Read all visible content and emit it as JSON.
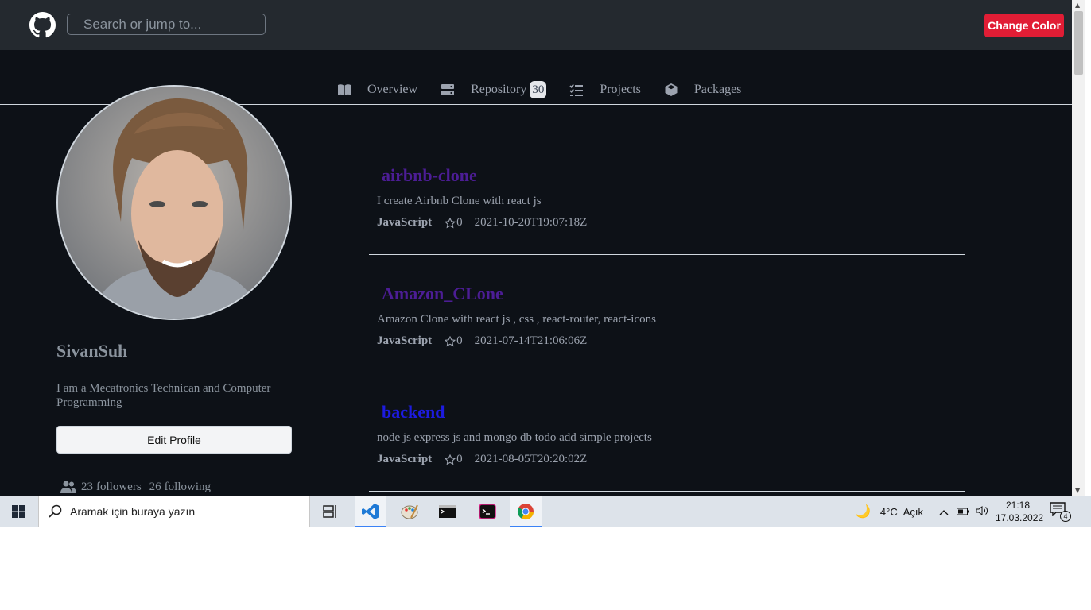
{
  "header": {
    "logo_icon": "github-icon",
    "search_placeholder": "Search or jump to...",
    "change_color_label": "Change Color",
    "change_color_bg": "#e11d35"
  },
  "tabs": [
    {
      "label": "Overview",
      "icon": "book-icon"
    },
    {
      "label": "Repository",
      "icon": "repo-icon",
      "count": "30"
    },
    {
      "label": "Projects",
      "icon": "projects-icon"
    },
    {
      "label": "Packages",
      "icon": "package-icon"
    }
  ],
  "profile": {
    "username": "SivanSuh",
    "bio": "I am a Mecatronics Technican and Computer Programming",
    "edit_label": "Edit Profile",
    "followers": "23",
    "followers_label": "followers",
    "following": "26",
    "following_label": "following"
  },
  "repos": [
    {
      "name": "airbnb-clone",
      "description": "I create Airbnb Clone with react js",
      "language": "JavaScript",
      "stars": "0",
      "date": "2021-10-20T19:07:18Z",
      "name_color": "#4c1d95"
    },
    {
      "name": "Amazon_CLone",
      "description": "Amazon Clone with react js , css , react-router, react-icons",
      "language": "JavaScript",
      "stars": "0",
      "date": "2021-07-14T21:06:06Z",
      "name_color": "#4c1d95"
    },
    {
      "name": "backend",
      "description": "node js express js and mongo db todo add simple projects",
      "language": "JavaScript",
      "stars": "0",
      "date": "2021-08-05T20:20:02Z",
      "name_color": "#1d1be0"
    }
  ],
  "taskbar": {
    "search_placeholder": "Aramak için buraya yazın",
    "weather_temp": "4°C",
    "weather_text": "Açık",
    "time": "21:18",
    "date": "17.03.2022",
    "notification_count": "4"
  }
}
